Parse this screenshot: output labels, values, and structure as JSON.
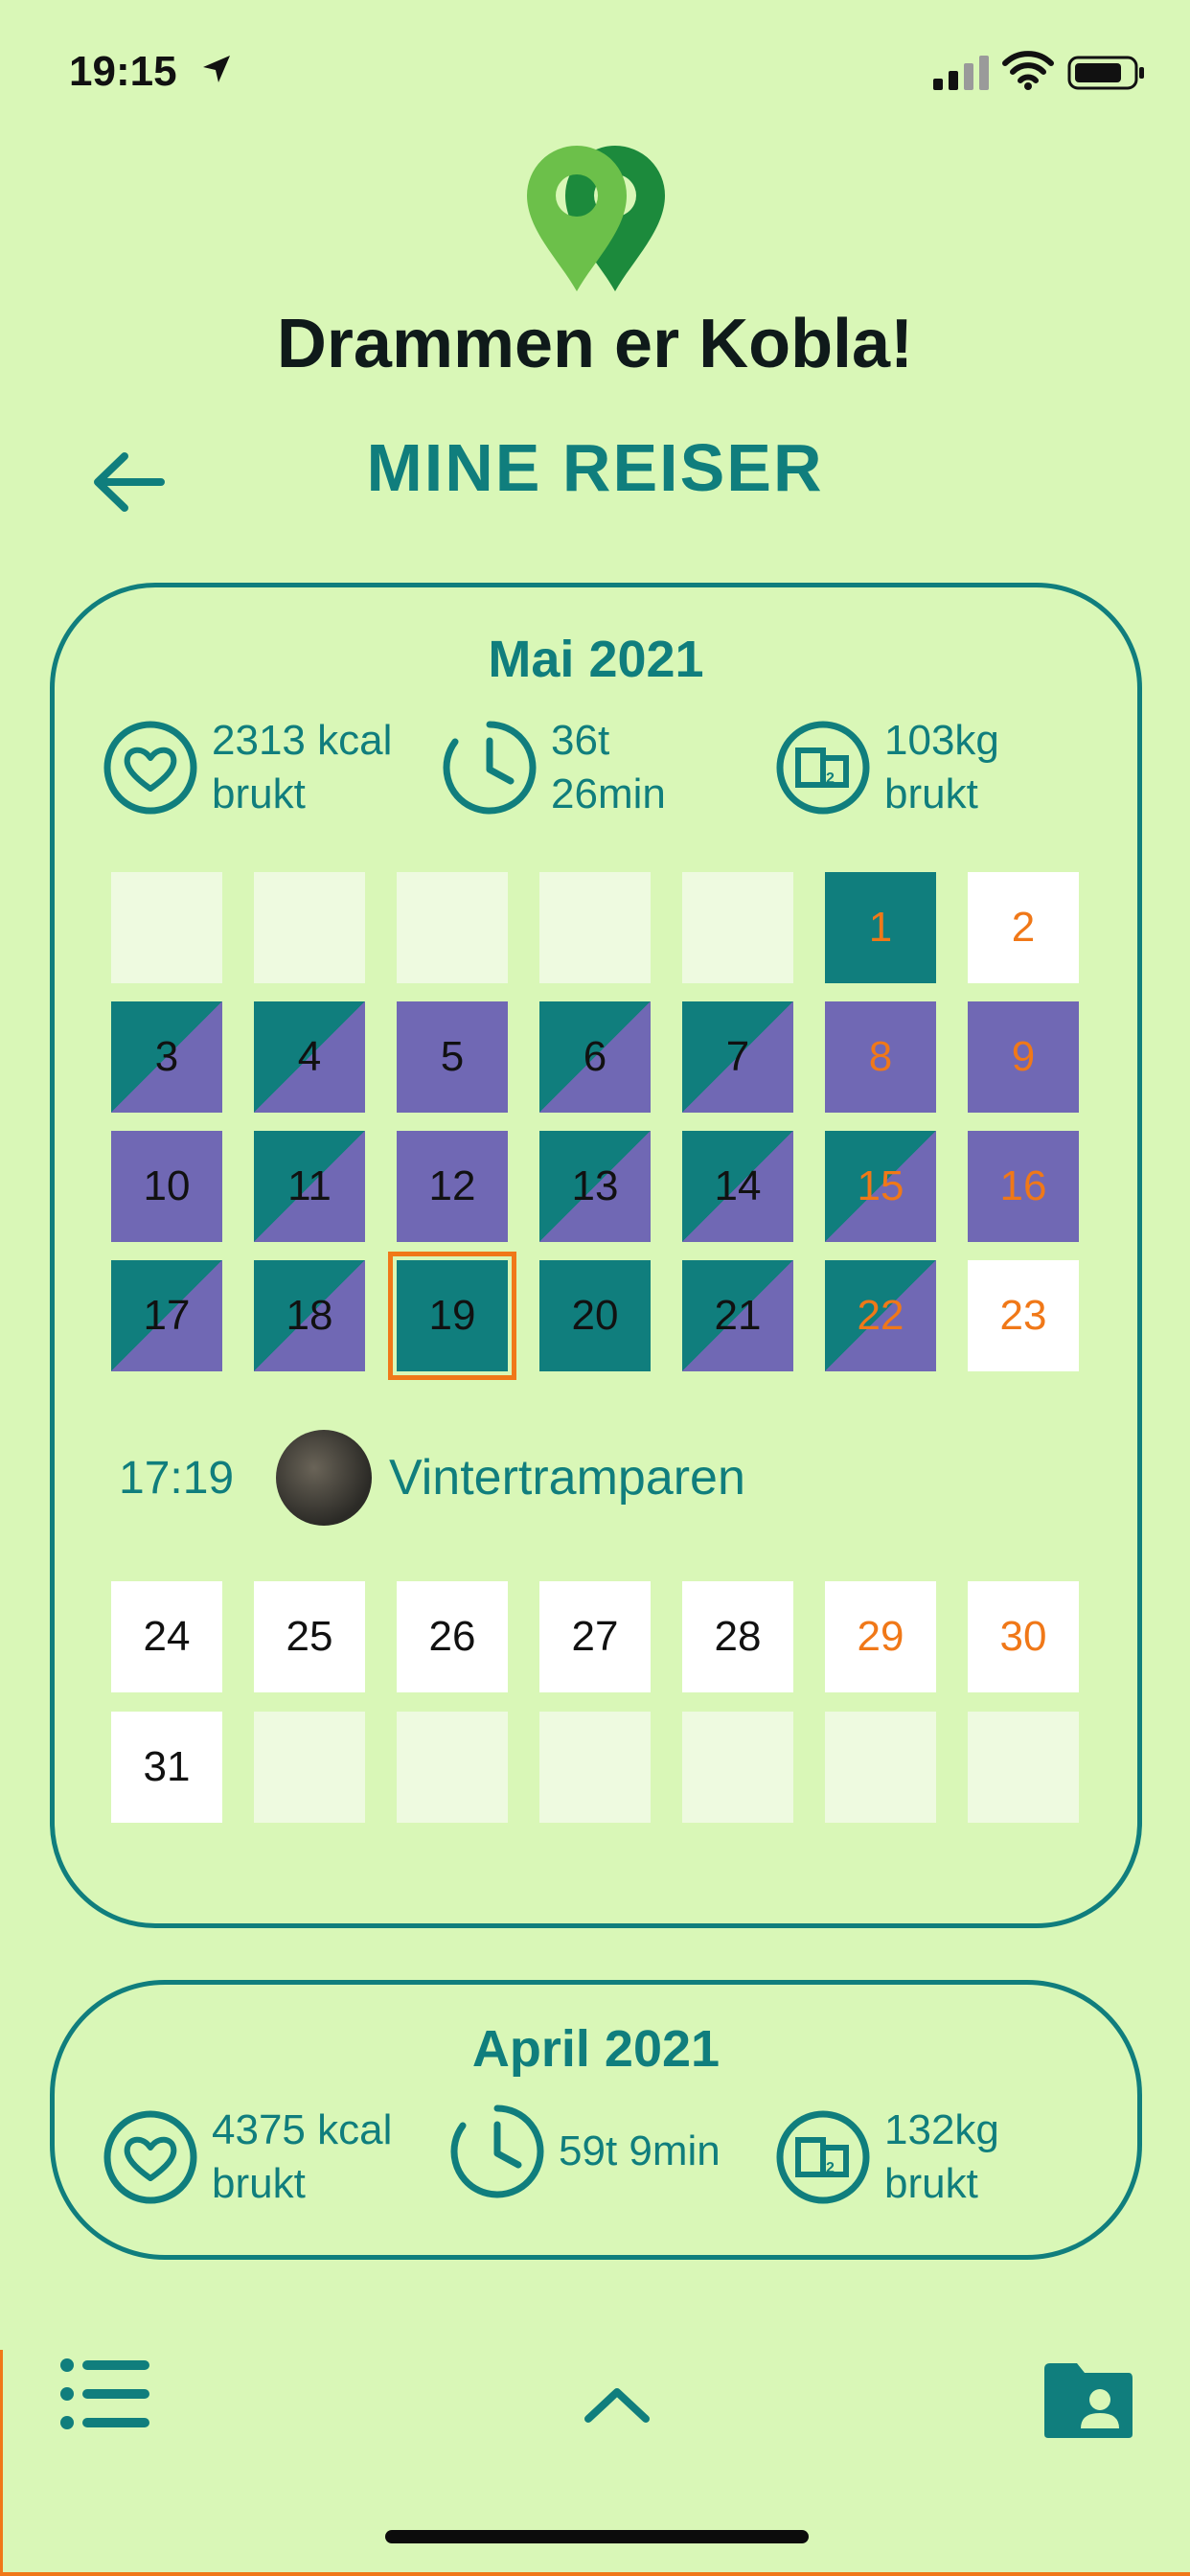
{
  "status_bar": {
    "time": "19:15"
  },
  "app": {
    "title": "Drammen er Kobla!"
  },
  "header": {
    "title": "MINE REISER"
  },
  "may": {
    "title": "Mai 2021",
    "stats": {
      "kcal": "2313 kcal\nbrukt",
      "time": "36t\n26min",
      "co2": "103kg\nbrukt"
    },
    "weeks": [
      [
        {
          "d": "",
          "t": "empty"
        },
        {
          "d": "",
          "t": "empty"
        },
        {
          "d": "",
          "t": "empty"
        },
        {
          "d": "",
          "t": "empty"
        },
        {
          "d": "",
          "t": "empty"
        },
        {
          "d": "1",
          "t": "teal",
          "w": true
        },
        {
          "d": "2",
          "t": "white",
          "w": true
        }
      ],
      [
        {
          "d": "3",
          "t": "split"
        },
        {
          "d": "4",
          "t": "split"
        },
        {
          "d": "5",
          "t": "purple"
        },
        {
          "d": "6",
          "t": "split"
        },
        {
          "d": "7",
          "t": "split"
        },
        {
          "d": "8",
          "t": "purple",
          "w": true
        },
        {
          "d": "9",
          "t": "purple",
          "w": true
        }
      ],
      [
        {
          "d": "10",
          "t": "purple"
        },
        {
          "d": "11",
          "t": "split"
        },
        {
          "d": "12",
          "t": "purple"
        },
        {
          "d": "13",
          "t": "split"
        },
        {
          "d": "14",
          "t": "split"
        },
        {
          "d": "15",
          "t": "split",
          "w": true
        },
        {
          "d": "16",
          "t": "purple",
          "w": true
        }
      ],
      [
        {
          "d": "17",
          "t": "split"
        },
        {
          "d": "18",
          "t": "split"
        },
        {
          "d": "19",
          "t": "teal",
          "sel": true
        },
        {
          "d": "20",
          "t": "teal"
        },
        {
          "d": "21",
          "t": "split"
        },
        {
          "d": "22",
          "t": "split",
          "w": true
        },
        {
          "d": "23",
          "t": "white",
          "w": true
        }
      ],
      [
        {
          "d": "24",
          "t": "white"
        },
        {
          "d": "25",
          "t": "white"
        },
        {
          "d": "26",
          "t": "white"
        },
        {
          "d": "27",
          "t": "white"
        },
        {
          "d": "28",
          "t": "white"
        },
        {
          "d": "29",
          "t": "white",
          "w": true
        },
        {
          "d": "30",
          "t": "white",
          "w": true
        }
      ],
      [
        {
          "d": "31",
          "t": "white"
        },
        {
          "d": "",
          "t": "empty"
        },
        {
          "d": "",
          "t": "empty"
        },
        {
          "d": "",
          "t": "empty"
        },
        {
          "d": "",
          "t": "empty"
        },
        {
          "d": "",
          "t": "empty"
        },
        {
          "d": "",
          "t": "empty"
        }
      ]
    ],
    "trip": {
      "time": "17:19",
      "name": "Vintertramparen"
    }
  },
  "april": {
    "title": "April 2021",
    "stats": {
      "kcal": "4375 kcal\nbrukt",
      "time": "59t 9min",
      "co2": "132kg\nbrukt"
    }
  },
  "colors": {
    "teal": "#107e7d",
    "purple": "#7068b4",
    "orange": "#f07818",
    "background": "#d9f7b7"
  }
}
